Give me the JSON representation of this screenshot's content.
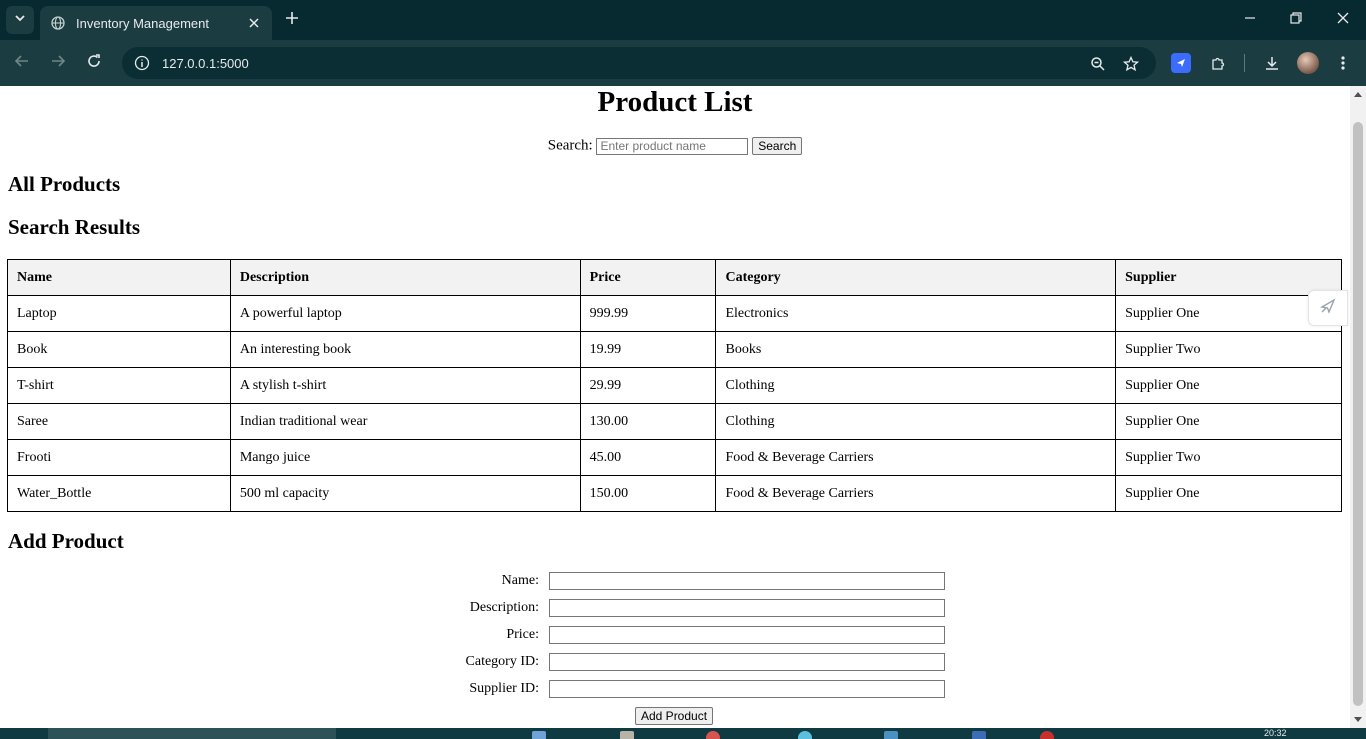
{
  "browser": {
    "tab_title": "Inventory Management",
    "url": "127.0.0.1:5000"
  },
  "page": {
    "heading": "Product List",
    "search": {
      "label": "Search:",
      "placeholder": "Enter product name",
      "button": "Search"
    },
    "all_products_heading": "All Products",
    "search_results_heading": "Search Results",
    "table": {
      "headers": [
        "Name",
        "Description",
        "Price",
        "Category",
        "Supplier"
      ],
      "rows": [
        [
          "Laptop",
          "A powerful laptop",
          "999.99",
          "Electronics",
          "Supplier One"
        ],
        [
          "Book",
          "An interesting book",
          "19.99",
          "Books",
          "Supplier Two"
        ],
        [
          "T-shirt",
          "A stylish t-shirt",
          "29.99",
          "Clothing",
          "Supplier One"
        ],
        [
          "Saree",
          "Indian traditional wear",
          "130.00",
          "Clothing",
          "Supplier One"
        ],
        [
          "Frooti",
          "Mango juice",
          "45.00",
          "Food & Beverage Carriers",
          "Supplier Two"
        ],
        [
          "Water_Bottle",
          "500 ml capacity",
          "150.00",
          "Food & Beverage Carriers",
          "Supplier One"
        ]
      ]
    },
    "add_product": {
      "heading": "Add Product",
      "fields": [
        "Name:",
        "Description:",
        "Price:",
        "Category ID:",
        "Supplier ID:"
      ],
      "submit": "Add Product"
    }
  },
  "taskbar": {
    "clock": "20:32"
  },
  "colors": {
    "chrome_dark": "#062a2f",
    "chrome_toolbar": "#1b3d42",
    "table_header_bg": "#f2f2f2"
  }
}
